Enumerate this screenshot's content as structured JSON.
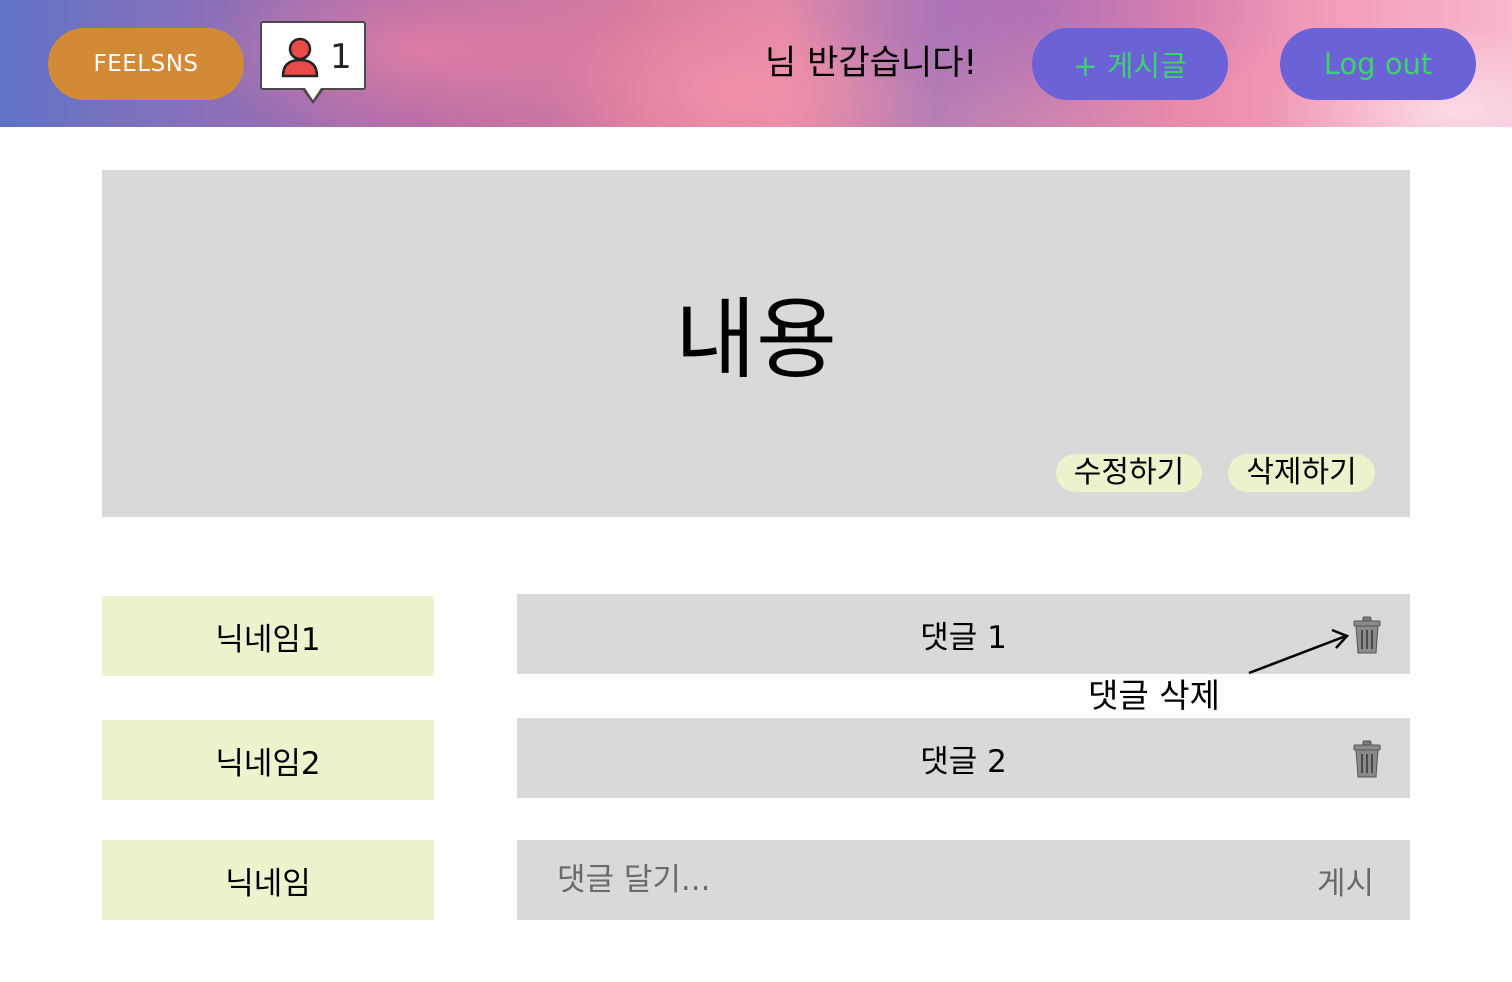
{
  "header": {
    "logo_label": "FEELSNS",
    "notification_count": "1",
    "greeting": "님 반갑습니다!",
    "new_post_label": "+ 게시글",
    "logout_label": "Log out",
    "icons": {
      "notification": "user-icon"
    }
  },
  "post": {
    "content": "내용",
    "edit_label": "수정하기",
    "delete_label": "삭제하기"
  },
  "comments": [
    {
      "nickname": "닉네임1",
      "text": "댓글 1",
      "icon": "trash-icon"
    },
    {
      "nickname": "닉네임2",
      "text": "댓글 2",
      "icon": "trash-icon"
    }
  ],
  "annotation": {
    "label": "댓글 삭제"
  },
  "new_comment": {
    "nickname": "닉네임",
    "placeholder": "댓글 달기...",
    "submit_label": "게시"
  },
  "colors": {
    "logo_button": "#d38a36",
    "header_button": "#6a62d6",
    "header_button_text": "#3dd36a",
    "panel_gray": "#d9d9d9",
    "nickname_bg": "#eef2cd",
    "notification_icon": "#e84a4a"
  }
}
